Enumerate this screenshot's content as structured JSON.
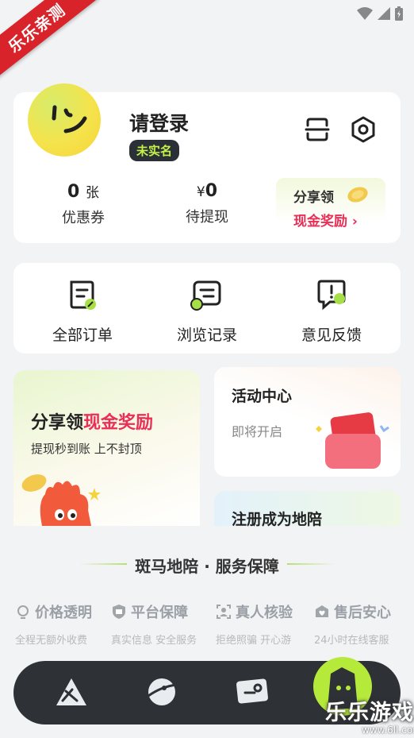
{
  "ribbon": {
    "text": "乐乐亲测"
  },
  "profile": {
    "login_title": "请登录",
    "real_name_badge": "未实名",
    "coupon": {
      "value": "0",
      "unit": "张",
      "label": "优惠券"
    },
    "withdraw": {
      "prefix": "¥",
      "value": "0",
      "label": "待提现"
    },
    "share": {
      "title": "分享领",
      "reward": "现金奖励 ›"
    }
  },
  "orders": [
    {
      "label": "全部订单",
      "icon": "order-icon"
    },
    {
      "label": "浏览记录",
      "icon": "history-icon"
    },
    {
      "label": "意见反馈",
      "icon": "feedback-icon"
    }
  ],
  "promo": {
    "title_prefix": "分享领",
    "title_highlight": "现金奖励",
    "subtitle": "提现秒到账 上不封顶"
  },
  "activity": {
    "title": "活动中心",
    "subtitle": "即将开启"
  },
  "register": {
    "title": "注册成为地陪"
  },
  "guarantee": {
    "title": "斑马地陪 · 服务保障",
    "features": [
      {
        "title": "价格透明",
        "subtitle": "全程无额外收费",
        "icon": "bulb-icon"
      },
      {
        "title": "平台保障",
        "subtitle": "真实信息 安全服务",
        "icon": "shield-icon"
      },
      {
        "title": "真人核验",
        "subtitle": "拒绝照骗 开心游",
        "icon": "person-icon"
      },
      {
        "title": "售后安心",
        "subtitle": "24小时在线客服",
        "icon": "heart-icon"
      }
    ]
  },
  "watermark": {
    "text": "乐乐游戏",
    "url": "www.6ll.com"
  },
  "colors": {
    "accent_green": "#c3f24a",
    "accent_red": "#ea2e55",
    "nav_bg": "#2e3136"
  }
}
